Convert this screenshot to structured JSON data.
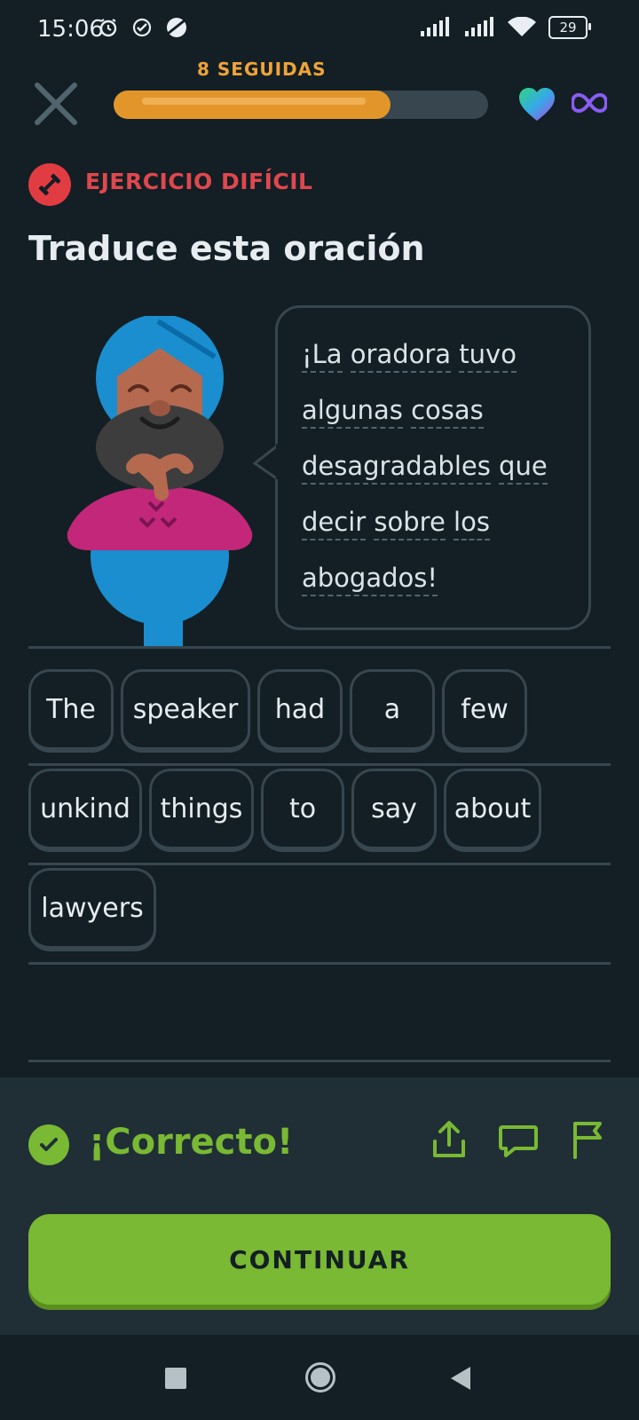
{
  "status_bar": {
    "time": "15:06",
    "battery": "29",
    "left_icons": [
      "alarm-icon",
      "check-circle-icon",
      "planet-icon"
    ],
    "right_icons": [
      "signal-icon",
      "signal-icon",
      "wifi-icon",
      "battery-icon"
    ]
  },
  "header": {
    "streak_label": "8 SEGUIDAS",
    "progress": 0.74,
    "icons": [
      "close-icon",
      "heart-icon",
      "infinity-icon"
    ]
  },
  "exercise": {
    "badge_label": "EJERCICIO DIFÍCIL",
    "title": "Traduce esta oración",
    "bubble_words": [
      "¡La",
      "oradora",
      "tuvo",
      "algunas",
      "cosas",
      "desagradables",
      "que",
      "decir",
      "sobre",
      "los",
      "abogados!"
    ]
  },
  "answer": {
    "chips": [
      "The",
      "speaker",
      "had",
      "a",
      "few",
      "unkind",
      "things",
      "to",
      "say",
      "about",
      "lawyers"
    ]
  },
  "feedback": {
    "message": "¡Correcto!",
    "continue_label": "CONTINUAR",
    "icons": [
      "share-icon",
      "comment-icon",
      "flag-icon"
    ]
  },
  "colors": {
    "background": "#131f24",
    "accent_green": "#79b933",
    "streak_orange": "#e2962a",
    "hard_red": "#e23c43"
  }
}
